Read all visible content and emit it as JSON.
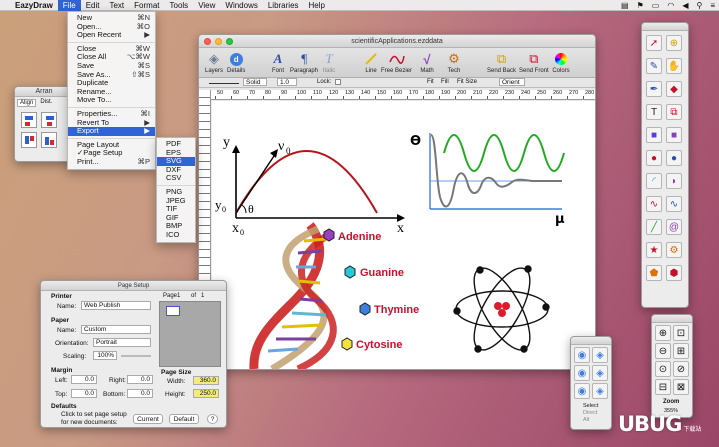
{
  "menubar": {
    "app": "EazyDraw",
    "items": [
      "File",
      "Edit",
      "Text",
      "Format",
      "Tools",
      "View",
      "Windows",
      "Libraries",
      "Help"
    ]
  },
  "file_menu": [
    {
      "label": "New",
      "shortcut": "⌘N"
    },
    {
      "label": "Open...",
      "shortcut": "⌘O"
    },
    {
      "label": "Open Recent",
      "shortcut": "▶"
    },
    {
      "sep": true
    },
    {
      "label": "Close",
      "shortcut": "⌘W"
    },
    {
      "label": "Close All",
      "shortcut": "⌥⌘W"
    },
    {
      "label": "Save",
      "shortcut": "⌘S"
    },
    {
      "label": "Save As...",
      "shortcut": "⇧⌘S"
    },
    {
      "label": "Duplicate",
      "shortcut": ""
    },
    {
      "label": "Rename...",
      "shortcut": ""
    },
    {
      "label": "Move To...",
      "shortcut": ""
    },
    {
      "sep": true
    },
    {
      "label": "Properties...",
      "shortcut": "⌘I"
    },
    {
      "label": "Revert To",
      "shortcut": "▶"
    },
    {
      "label": "Export",
      "shortcut": "▶",
      "highlight": true
    },
    {
      "sep": true
    },
    {
      "label": "Page Layout",
      "shortcut": ""
    },
    {
      "label": "✓Page Setup",
      "shortcut": ""
    },
    {
      "label": "Print...",
      "shortcut": "⌘P"
    }
  ],
  "export_menu": [
    {
      "label": "PDF"
    },
    {
      "label": "EPS"
    },
    {
      "label": "SVG",
      "highlight": true
    },
    {
      "label": "DXF"
    },
    {
      "label": "CSV"
    },
    {
      "sep": true
    },
    {
      "label": "PNG"
    },
    {
      "label": "JPEG"
    },
    {
      "label": "TIF"
    },
    {
      "label": "GIF"
    },
    {
      "label": "BMP"
    },
    {
      "label": "ICO"
    }
  ],
  "arrange": {
    "title": "Arran",
    "tabs": [
      "Align",
      "Dist.",
      ""
    ]
  },
  "doc": {
    "title": "scientificApplications.ezddata",
    "toolbar": [
      {
        "label": "Layers",
        "icon": "layers-icon"
      },
      {
        "label": "Details",
        "icon": "details-icon"
      },
      {
        "label": "Font",
        "icon": "font-icon"
      },
      {
        "label": "Paragraph",
        "icon": "paragraph-icon"
      },
      {
        "label": "Italic",
        "icon": "italic-icon"
      },
      {
        "label": "Line",
        "icon": "line-icon"
      },
      {
        "label": "Free Bezier",
        "icon": "bezier-icon"
      },
      {
        "label": "Math",
        "icon": "math-icon"
      },
      {
        "label": "Tech",
        "icon": "tech-icon"
      },
      {
        "label": "Send Back",
        "icon": "send-back-icon"
      },
      {
        "label": "Send Front",
        "icon": "send-front-icon"
      },
      {
        "label": "Colors",
        "icon": "colors-icon"
      }
    ],
    "style_bar": {
      "stroke": "Solid",
      "width": "1.0",
      "lock": "Lock:",
      "fit": "Fit",
      "fill": "Fill",
      "fitsize": "Fit Size",
      "orient": "Orient"
    },
    "ruler_ticks": [
      "50",
      "60",
      "70",
      "80",
      "90",
      "100",
      "110",
      "120",
      "130",
      "140",
      "150",
      "160",
      "170",
      "180",
      "190",
      "200",
      "210",
      "220",
      "230",
      "240",
      "250",
      "260",
      "270",
      "280"
    ]
  },
  "art": {
    "proj_y": "y",
    "proj_v0": "ν",
    "proj_v0_sub": "0",
    "proj_y0": "y",
    "proj_y0_sub": "0",
    "proj_theta": "θ",
    "proj_x0": "x",
    "proj_x0_sub": "0",
    "proj_x": "x",
    "wave_theta": "ϴ",
    "wave_mu": "μ",
    "dna_labels": [
      "Adenine",
      "Guanine",
      "Thymine",
      "Cytosine"
    ],
    "label_color": "#c8102e"
  },
  "page_setup": {
    "title": "Page Setup",
    "printer_header": "Printer",
    "name_label": "Name:",
    "printer_name": "Web Publish",
    "paper_header": "Paper",
    "paper_name": "Custom",
    "orientation_label": "Orientation:",
    "orientation": "Portrait",
    "scaling_label": "Scaling:",
    "scaling": "100%",
    "margin_header": "Margin",
    "left_label": "Left:",
    "left": "0.0",
    "right_label": "Right:",
    "right": "0.0",
    "top_label": "Top:",
    "top": "0.0",
    "bottom_label": "Bottom:",
    "bottom": "0.0",
    "page_label": "Page1",
    "of_label": "of",
    "of_count": "1",
    "page_size_header": "Page Size",
    "width_label": "Width:",
    "width": "360.0",
    "height_label": "Height:",
    "height": "250.0",
    "defaults_header": "Defaults",
    "defaults_text1": "Click to set page setup",
    "defaults_text2": "for new documents:",
    "current_btn": "Current",
    "default_btn": "Default",
    "help_btn": "?"
  },
  "zoom": {
    "label": "Zoom",
    "value": "355%"
  },
  "select_panel": {
    "options": [
      "Select",
      "Direct",
      "Alt"
    ]
  },
  "watermark": "UBUG",
  "watermark_sub": "下载站"
}
